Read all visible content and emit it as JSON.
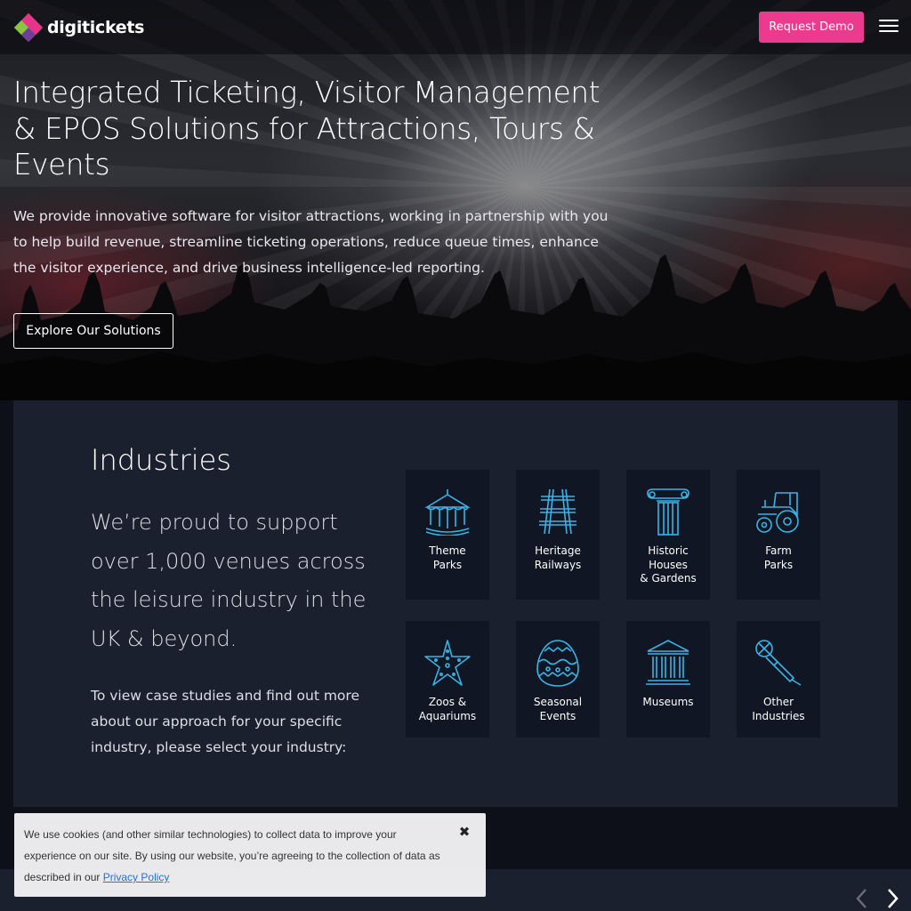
{
  "header": {
    "logo_text": "digitickets",
    "demo_label": "Request Demo"
  },
  "hero": {
    "title": "Integrated Ticketing, Visitor Management & EPOS Solutions for Attractions, Tours & Events",
    "subtitle": "We provide innovative software for visitor attractions, working in partnership with you to help build revenue, streamline ticketing operations, reduce queue times, enhance the visitor experience, and drive business intelligence-led reporting.",
    "cta_label": "Explore Our Solutions"
  },
  "industries": {
    "title": "Industries",
    "lead": "We’re proud to support over 1,000 venues across the leisure industry in the UK & beyond.",
    "body": "To view case studies and find out more about our approach for your specific industry, please select your industry:",
    "tiles": [
      {
        "label": "Theme\nParks",
        "icon": "carousel-icon"
      },
      {
        "label": "Heritage\nRailways",
        "icon": "railway-track-icon"
      },
      {
        "label": "Historic\nHouses\n& Gardens",
        "icon": "column-icon"
      },
      {
        "label": "Farm\nParks",
        "icon": "tractor-icon"
      },
      {
        "label": "Zoos &\nAquariums",
        "icon": "starfish-icon"
      },
      {
        "label": "Seasonal\nEvents",
        "icon": "easter-egg-icon"
      },
      {
        "label": "Museums",
        "icon": "museum-icon"
      },
      {
        "label": "Other\nIndustries",
        "icon": "microphone-icon"
      }
    ]
  },
  "cookie": {
    "text": "We use cookies (and other similar technologies) to collect data to improve your experience on our site. By using our website, you’re agreeing to the collection of data as described in our ",
    "link_label": "Privacy Policy",
    "close_glyph": "✖"
  },
  "colors": {
    "accent_pink": "#ec3a8e",
    "panel": "#1b202e",
    "tile": "#101624",
    "icon_blue": "#3ab4e6"
  }
}
